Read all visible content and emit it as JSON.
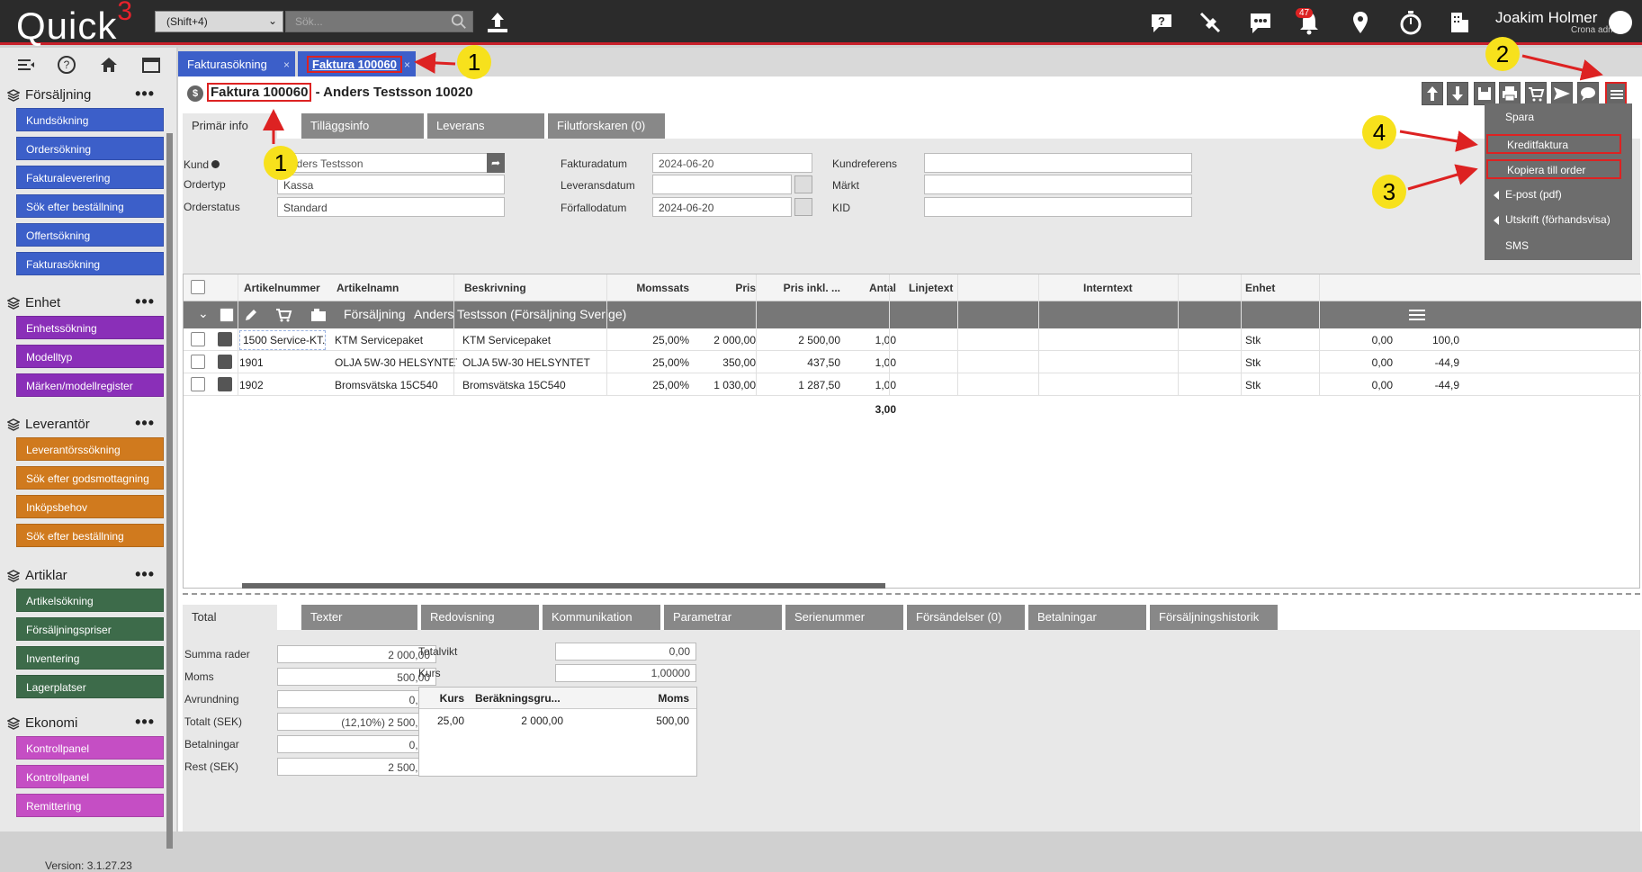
{
  "app": {
    "logo_text": "Quick",
    "logo_sup": "3",
    "scope_select": "(Shift+4)",
    "search_placeholder": "Sök...",
    "notifications_count": "47",
    "user_name": "Joakim Holmer",
    "user_role": "Crona admin",
    "version": "Version: 3.1.27.23"
  },
  "sidebar": {
    "sections": [
      {
        "title": "Försäljning",
        "color": "#3c5fc9",
        "items": [
          "Kundsökning",
          "Ordersökning",
          "Fakturaleverering",
          "Sök efter beställning",
          "Offertsökning",
          "Fakturasökning"
        ]
      },
      {
        "title": "Enhet",
        "color": "#8a2fb8",
        "items": [
          "Enhetssökning",
          "Modelltyp",
          "Märken/modellregister"
        ]
      },
      {
        "title": "Leverantör",
        "color": "#d07a1e",
        "items": [
          "Leverantörssökning",
          "Sök efter godsmottagning",
          "Inköpsbehov",
          "Sök efter beställning"
        ]
      },
      {
        "title": "Artiklar",
        "color": "#3d6b4a",
        "items": [
          "Artikelsökning",
          "Försäljningspriser",
          "Inventering",
          "Lagerplatser"
        ]
      },
      {
        "title": "Ekonomi",
        "color": "#c54ec4",
        "items": [
          "Kontrollpanel",
          "Kontrollpanel",
          "Remittering"
        ]
      }
    ]
  },
  "tabs": [
    "Fakturasökning",
    "Faktura 100060"
  ],
  "header": {
    "invoice": "Faktura 100060",
    "rest": " - Anders Testsson 10020"
  },
  "subtabs": [
    "Primär info",
    "Tilläggsinfo",
    "Leverans",
    "Filutforskaren (0)"
  ],
  "form": {
    "kund_label": "Kund",
    "kund": "Anders Testsson",
    "ordertyp_label": "Ordertyp",
    "ordertyp": "Kassa",
    "orderstatus_label": "Orderstatus",
    "orderstatus": "Standard",
    "fakturadatum_label": "Fakturadatum",
    "fakturadatum": "2024-06-20",
    "leveransdatum_label": "Leveransdatum",
    "leveransdatum": "",
    "forfallodatum_label": "Förfallodatum",
    "forfallodatum": "2024-06-20",
    "kundreferens_label": "Kundreferens",
    "markt_label": "Märkt",
    "kid_label": "KID"
  },
  "grid": {
    "headers": [
      "Artikelnummer",
      "Artikelnamn",
      "Beskrivning",
      "Momssats",
      "Pris",
      "Pris inkl. ...",
      "Antal",
      "Linjetext",
      "Interntext",
      "Enhet"
    ],
    "group_label": "Försäljning",
    "group_customer": "Anders Testsson (Försäljning Sverige)",
    "rows": [
      {
        "nr": "1500 Service-KT...",
        "name": "KTM Servicepaket",
        "desc": "KTM Servicepaket",
        "moms": "25,00%",
        "pris": "2 000,00",
        "inkl": "2 500,00",
        "antal": "1,00",
        "enhet": "Stk",
        "c1": "0,00",
        "c2": "100,0"
      },
      {
        "nr": "1901",
        "name": "OLJA 5W-30 HELSYNTET",
        "desc": "OLJA 5W-30 HELSYNTET",
        "moms": "25,00%",
        "pris": "350,00",
        "inkl": "437,50",
        "antal": "1,00",
        "enhet": "Stk",
        "c1": "0,00",
        "c2": "-44,9"
      },
      {
        "nr": "1902",
        "name": "Bromsvätska 15C540",
        "desc": "Bromsvätska 15C540",
        "moms": "25,00%",
        "pris": "1 030,00",
        "inkl": "1 287,50",
        "antal": "1,00",
        "enhet": "Stk",
        "c1": "0,00",
        "c2": "-44,9"
      }
    ],
    "total_antal": "3,00"
  },
  "bottomtabs": [
    "Total",
    "Texter",
    "Redovisning",
    "Kommunikation",
    "Parametrar",
    "Serienummer",
    "Försändelser (0)",
    "Betalningar",
    "Försäljningshistorik"
  ],
  "totals": {
    "labels": [
      "Summa rader",
      "Moms",
      "Avrundning",
      "Totalt (SEK)",
      "Betalningar",
      "Rest (SEK)"
    ],
    "values": [
      "2 000,00",
      "500,00",
      "0,00",
      "(12,10%) 2 500,00",
      "0,00",
      "2 500,00"
    ],
    "totalvikt_label": "Totalvikt",
    "totalvikt": "0,00",
    "kurs_label": "Kurs",
    "kurs": "1,00000",
    "vat_headers": [
      "Kurs",
      "Beräkningsgru...",
      "Moms"
    ],
    "vat_row": [
      "25,00",
      "2 000,00",
      "500,00"
    ]
  },
  "menu": [
    "Spara",
    "Kreditfaktura",
    "Kopiera till order",
    "E-post (pdf)",
    "Utskrift (förhandsvisa)",
    "SMS"
  ],
  "callouts": [
    "1",
    "1",
    "2",
    "3",
    "4"
  ]
}
